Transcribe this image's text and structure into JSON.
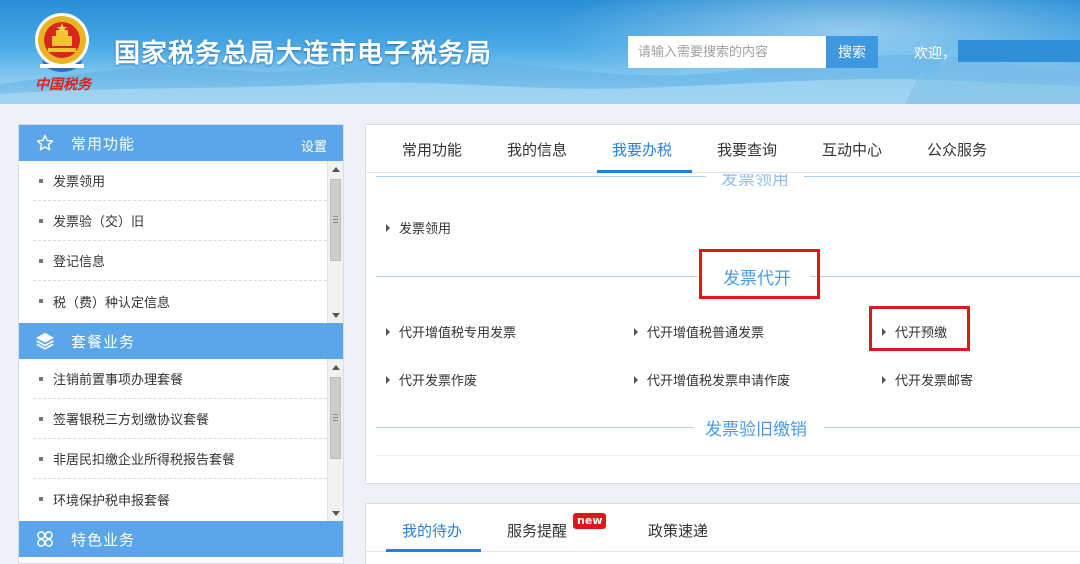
{
  "header": {
    "title": "国家税务总局大连市电子税务局",
    "emblem_caption": "中国税务",
    "search_placeholder": "请输入需要搜索的内容",
    "search_button": "搜索",
    "welcome": "欢迎，"
  },
  "left": {
    "sections": [
      {
        "title": "常用功能",
        "icon": "star-icon",
        "setting": "设置",
        "items": [
          "发票领用",
          "发票验（交）旧",
          "登记信息",
          "税（费）种认定信息"
        ]
      },
      {
        "title": "套餐业务",
        "icon": "layers-icon",
        "items": [
          "注销前置事项办理套餐",
          "签署银税三方划缴协议套餐",
          "非居民扣缴企业所得税报告套餐",
          "环境保护税申报套餐"
        ]
      },
      {
        "title": "特色业务",
        "icon": "clover-icon"
      }
    ]
  },
  "main": {
    "tabs": [
      "常用功能",
      "我的信息",
      "我要办税",
      "我要查询",
      "互动中心",
      "公众服务"
    ],
    "active_tab": "我要办税",
    "clipped_title": "发票领用",
    "groups": [
      {
        "title": "发票领用",
        "items": [
          "发票领用"
        ]
      },
      {
        "title": "发票代开",
        "items": [
          "代开增值税专用发票",
          "代开增值税普通发票",
          "代开预缴",
          "代开发票作废",
          "代开增值税发票申请作废",
          "代开发票邮寄"
        ]
      },
      {
        "title": "发票验旧缴销"
      }
    ]
  },
  "bottom": {
    "tabs": [
      "我的待办",
      "服务提醒",
      "政策速递"
    ],
    "active_tab": "我的待办",
    "badge": "new"
  },
  "colors": {
    "accent": "#2a7fd4",
    "section_header": "#5ba6ea",
    "highlight_box": "#e0161b"
  }
}
